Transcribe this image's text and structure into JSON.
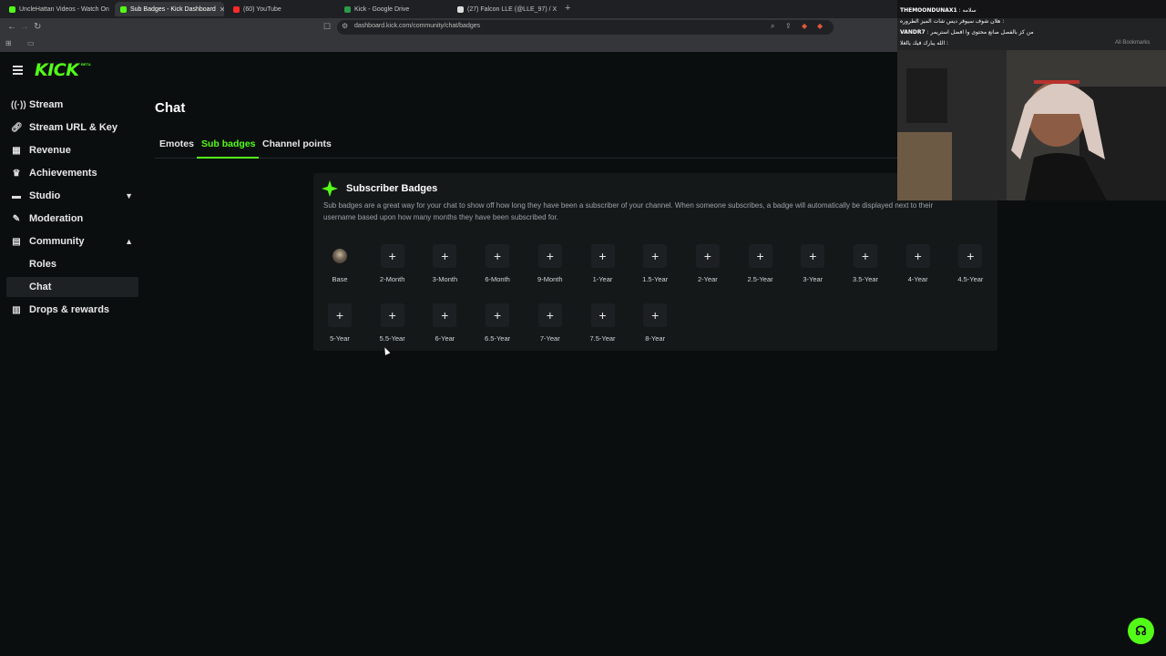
{
  "browser": {
    "tabs": [
      {
        "title": "UncleHattan Videos - Watch On",
        "fav": "#53fc18"
      },
      {
        "title": "Sub Badges - Kick Dashboard",
        "fav": "#53fc18",
        "active": true
      },
      {
        "title": "(60) YouTube",
        "fav": "#ff2a2a"
      },
      {
        "title": "Kick - Google Drive",
        "fav": "#2b9a4a"
      },
      {
        "title": "(27) Falcon LLE (@LLE_97) / X",
        "fav": "#dddddd"
      }
    ],
    "url": "dashboard.kick.com/community/chat/badges",
    "all_bookmarks": "All Bookmarks"
  },
  "logo": {
    "text": "KICK",
    "tag": "BETA"
  },
  "sidebar": {
    "items": [
      {
        "label": "Stream",
        "icon": "broadcast-icon"
      },
      {
        "label": "Stream URL & Key",
        "icon": "link-icon"
      },
      {
        "label": "Revenue",
        "icon": "revenue-icon"
      },
      {
        "label": "Achievements",
        "icon": "trophy-icon"
      },
      {
        "label": "Studio",
        "icon": "studio-icon"
      },
      {
        "label": "Moderation",
        "icon": "wrench-icon"
      },
      {
        "label": "Community",
        "icon": "community-icon"
      },
      {
        "label": "Roles"
      },
      {
        "label": "Chat"
      },
      {
        "label": "Drops & rewards",
        "icon": "gift-icon"
      }
    ]
  },
  "page": {
    "title": "Chat",
    "tabs": [
      "Emotes",
      "Sub badges",
      "Channel points"
    ],
    "active_tab": "Sub badges"
  },
  "card": {
    "title": "Subscriber Badges",
    "description": "Sub badges are a great way for your chat to show off how long they have been a subscriber of your channel. When someone subscribes, a badge will automatically be displayed next to their username based upon how many months they have been subscribed for.",
    "badges_row1": [
      "Base",
      "2-Month",
      "3-Month",
      "6-Month",
      "9-Month",
      "1-Year",
      "1.5-Year",
      "2-Year",
      "2.5-Year",
      "3-Year",
      "3.5-Year",
      "4-Year",
      "4.5-Year"
    ],
    "badges_row2": [
      "5-Year",
      "5.5-Year",
      "6-Year",
      "6.5-Year",
      "7-Year",
      "7.5-Year",
      "8-Year"
    ],
    "add_symbol": "+"
  },
  "overlay": {
    "messages": [
      {
        "user": "THEMOONDUNAX1",
        "text": " : سلامه"
      },
      {
        "user": "",
        "text": "هلان شوف سيوفر ديس شات الميز الطروره :"
      },
      {
        "user": "VANDR7",
        "text": " : من كز بالفصل صانع محتوى وا افضل استريمر"
      },
      {
        "user": "",
        "text": "الله يبارك فيك يالغلا :"
      }
    ]
  },
  "colors": {
    "accent": "#53fc18",
    "background": "#0b0e0f",
    "card": "#151819"
  }
}
